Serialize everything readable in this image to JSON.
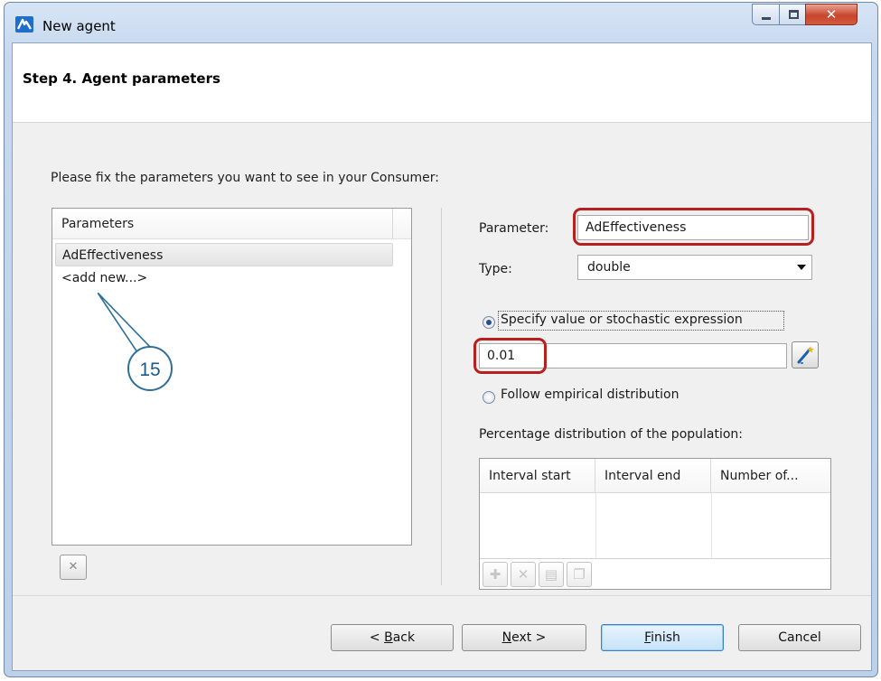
{
  "window": {
    "title": "New agent",
    "icon": "anylogic-app-icon",
    "controls": {
      "minimize": "minimize-icon",
      "maximize": "maximize-icon",
      "close": "close-icon"
    }
  },
  "header": {
    "step_title": "Step 4. Agent parameters"
  },
  "instruction": "Please fix the parameters you want to see in your Consumer:",
  "parameters_list": {
    "header": "Parameters",
    "items": [
      "AdEffectiveness",
      "<add new...>"
    ],
    "selected_index": 0
  },
  "callout": {
    "number": "15"
  },
  "form": {
    "parameter_label": "Parameter:",
    "parameter_value": "AdEffectiveness",
    "type_label": "Type:",
    "type_value": "double",
    "radio_specify": {
      "label": "Specify value or stochastic expression",
      "checked": true
    },
    "value_expression": "0.01",
    "radio_empirical": {
      "label": "Follow empirical distribution",
      "checked": false
    },
    "distribution_label": "Percentage distribution of the population:",
    "distribution_columns": [
      "Interval start",
      "Interval end",
      "Number of..."
    ],
    "highlight_color": "#b81f1f"
  },
  "buttons": {
    "back": {
      "pre": "< ",
      "u": "B",
      "post": "ack"
    },
    "next": {
      "pre": "",
      "u": "N",
      "post": "ext >"
    },
    "finish": {
      "pre": "",
      "u": "F",
      "post": "inish"
    },
    "cancel": {
      "pre": "",
      "u": "",
      "post": "Cancel"
    }
  }
}
